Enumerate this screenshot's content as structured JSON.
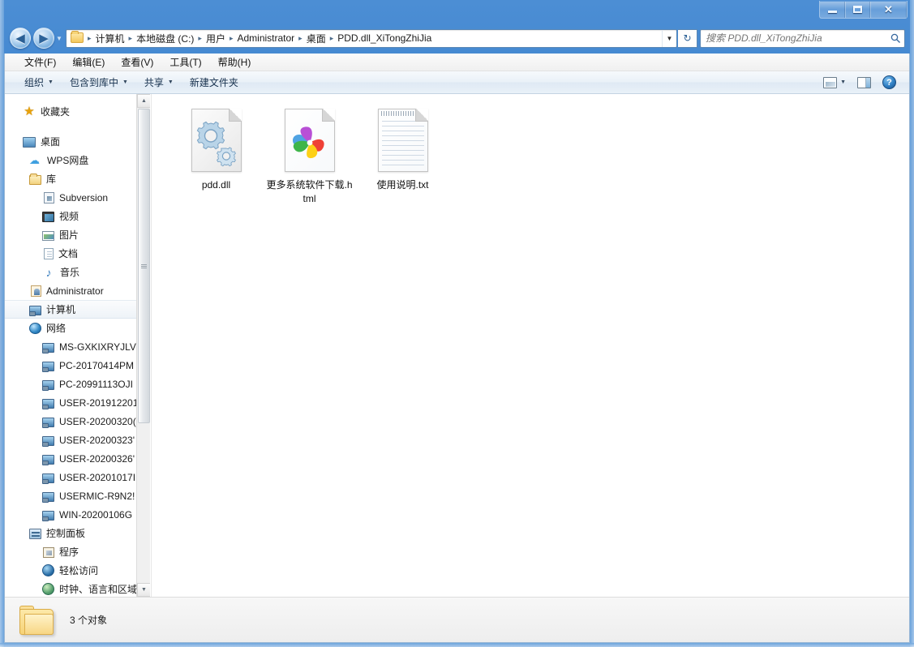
{
  "window": {
    "controls": {
      "minimize": "–",
      "maximize": "□",
      "close": "✕"
    }
  },
  "nav": {
    "back_icon": "◀",
    "forward_icon": "▶",
    "history_caret": "▼",
    "refresh_icon": "↻",
    "dropdown_caret": "▼"
  },
  "address": {
    "root_icon": "folder-icon",
    "separator": "▸",
    "crumbs": [
      "计算机",
      "本地磁盘 (C:)",
      "用户",
      "Administrator",
      "桌面",
      "PDD.dll_XiTongZhiJia"
    ]
  },
  "search": {
    "placeholder": "搜索 PDD.dll_XiTongZhiJia",
    "icon": "🔍"
  },
  "menubar": {
    "items": [
      "文件(F)",
      "编辑(E)",
      "查看(V)",
      "工具(T)",
      "帮助(H)"
    ]
  },
  "toolbar": {
    "buttons": [
      {
        "label": "组织",
        "caret": "▼"
      },
      {
        "label": "包含到库中",
        "caret": "▼"
      },
      {
        "label": "共享",
        "caret": "▼"
      },
      {
        "label": "新建文件夹",
        "caret": ""
      }
    ],
    "right": {
      "views_caret": "▼",
      "help_glyph": "?"
    }
  },
  "sidebar": {
    "items": [
      {
        "label": "收藏夹",
        "icon": "star-icon",
        "level": 0,
        "selected": false
      },
      {
        "label": "桌面",
        "icon": "desktop-icon",
        "level": 0,
        "selected": false,
        "gap_before": true
      },
      {
        "label": "WPS网盘",
        "icon": "cloud-icon",
        "level": 1,
        "selected": false
      },
      {
        "label": "库",
        "icon": "library-icon",
        "level": 1,
        "selected": false
      },
      {
        "label": "Subversion",
        "icon": "subversion-icon",
        "level": 2,
        "selected": false
      },
      {
        "label": "视频",
        "icon": "video-icon",
        "level": 2,
        "selected": false
      },
      {
        "label": "图片",
        "icon": "pictures-icon",
        "level": 2,
        "selected": false
      },
      {
        "label": "文档",
        "icon": "documents-icon",
        "level": 2,
        "selected": false
      },
      {
        "label": "音乐",
        "icon": "music-icon",
        "level": 2,
        "selected": false
      },
      {
        "label": "Administrator",
        "icon": "user-icon",
        "level": 1,
        "selected": false
      },
      {
        "label": "计算机",
        "icon": "computer-icon",
        "level": 1,
        "selected": true
      },
      {
        "label": "网络",
        "icon": "network-icon",
        "level": 1,
        "selected": false
      },
      {
        "label": "MS-GXKIXRYJLV",
        "icon": "network-pc-icon",
        "level": 2,
        "selected": false
      },
      {
        "label": "PC-20170414PM",
        "icon": "network-pc-icon",
        "level": 2,
        "selected": false
      },
      {
        "label": "PC-20991113OJI",
        "icon": "network-pc-icon",
        "level": 2,
        "selected": false
      },
      {
        "label": "USER-201912201",
        "icon": "network-pc-icon",
        "level": 2,
        "selected": false
      },
      {
        "label": "USER-20200320(",
        "icon": "network-pc-icon",
        "level": 2,
        "selected": false
      },
      {
        "label": "USER-20200323'",
        "icon": "network-pc-icon",
        "level": 2,
        "selected": false
      },
      {
        "label": "USER-20200326'",
        "icon": "network-pc-icon",
        "level": 2,
        "selected": false
      },
      {
        "label": "USER-20201017I",
        "icon": "network-pc-icon",
        "level": 2,
        "selected": false
      },
      {
        "label": "USERMIC-R9N2!",
        "icon": "network-pc-icon",
        "level": 2,
        "selected": false
      },
      {
        "label": "WIN-20200106G",
        "icon": "network-pc-icon",
        "level": 2,
        "selected": false
      },
      {
        "label": "控制面板",
        "icon": "control-panel-icon",
        "level": 1,
        "selected": false
      },
      {
        "label": "程序",
        "icon": "programs-icon",
        "level": 2,
        "selected": false
      },
      {
        "label": "轻松访问",
        "icon": "ease-of-access-icon",
        "level": 2,
        "selected": false
      },
      {
        "label": "时钟、语言和区域",
        "icon": "clock-language-region-icon",
        "level": 2,
        "selected": false
      }
    ],
    "scroll_up": "▲",
    "scroll_down": "▼"
  },
  "files": [
    {
      "name": "pdd.dll",
      "icon": "dll-gears-icon"
    },
    {
      "name": "更多系统软件下载.html",
      "icon": "browser-pinwheel-icon"
    },
    {
      "name": "使用说明.txt",
      "icon": "text-notepad-icon"
    }
  ],
  "statusbar": {
    "count_text": "3 个对象",
    "folder_icon": "folder-large-icon"
  },
  "colors": {
    "frame_blue": "#3c82cd",
    "toolbar_blue": "#e9f1f8",
    "accent": "#2f7fc4"
  }
}
